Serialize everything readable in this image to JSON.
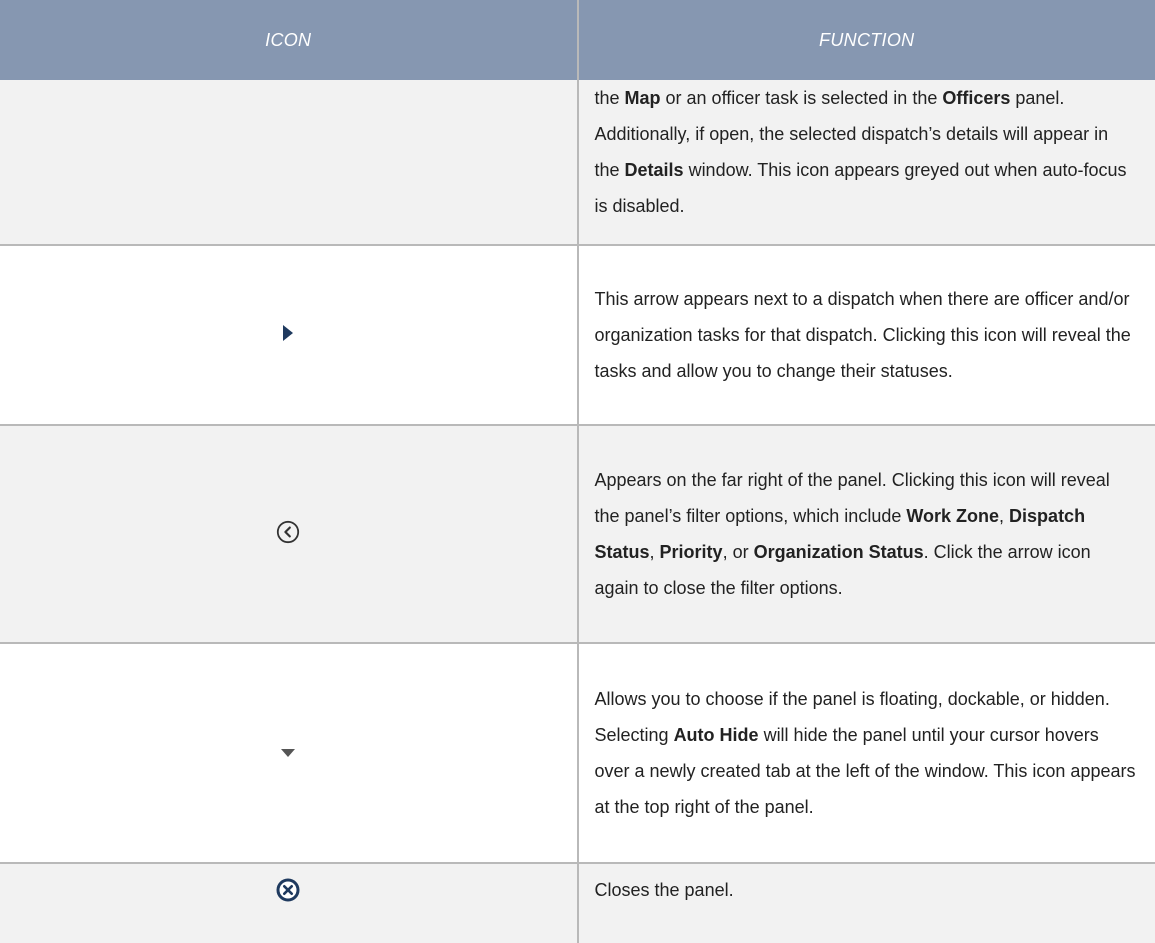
{
  "table": {
    "header": {
      "icon": "ICON",
      "function": "FUNCTION"
    },
    "rows": [
      {
        "icon": "none",
        "description": [
          {
            "t": "the "
          },
          {
            "b": "Map"
          },
          {
            "t": " or an officer task is selected in the "
          },
          {
            "b": "Officers"
          },
          {
            "t": " panel. Additionally, if open, the selected dispatch’s details will appear in the "
          },
          {
            "b": "Details"
          },
          {
            "t": " window. This icon appears greyed out when auto-focus is disabled."
          }
        ]
      },
      {
        "icon": "caret-right-icon",
        "description": [
          {
            "t": "This arrow appears next to a dispatch when there are officer and/or organization tasks for that dispatch. Clicking this icon will reveal the tasks and allow you to change their statuses."
          }
        ]
      },
      {
        "icon": "circle-chevron-left-icon",
        "description": [
          {
            "t": "Appears on the far right of the panel. Clicking this icon will reveal the panel’s filter options, which include "
          },
          {
            "b": "Work Zone"
          },
          {
            "t": ", "
          },
          {
            "b": "Dispatch Status"
          },
          {
            "t": ", "
          },
          {
            "b": "Priority"
          },
          {
            "t": ", or "
          },
          {
            "b": "Organization Status"
          },
          {
            "t": ". Click the arrow icon again to close the filter options."
          }
        ]
      },
      {
        "icon": "caret-down-icon",
        "description": [
          {
            "t": "Allows you to choose if the panel is floating, dockable, or hidden. Selecting "
          },
          {
            "b": "Auto Hide"
          },
          {
            "t": " will hide the panel until your cursor hovers over a newly created tab at the left of the window. This icon appears at the top right of the panel."
          }
        ]
      },
      {
        "icon": "close-circle-icon",
        "description": [
          {
            "t": "Closes the panel."
          }
        ]
      }
    ]
  },
  "colors": {
    "header_bg": "#8697b1",
    "header_text": "#ffffff",
    "row_shade": "#f2f2f2",
    "grid_line": "#b9b9b9",
    "icon_navy": "#1f3a5f",
    "icon_grey": "#555555"
  }
}
